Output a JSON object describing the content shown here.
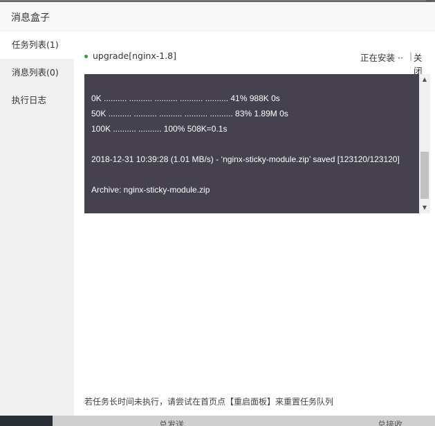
{
  "background": {
    "bottom_left_label": "总发送",
    "bottom_right_label": "总接收"
  },
  "modal": {
    "title": "消息盒子"
  },
  "sidebar": {
    "items": [
      {
        "label": "任务列表(1)",
        "active": true
      },
      {
        "label": "消息列表(0)",
        "active": false
      },
      {
        "label": "执行日志",
        "active": false
      }
    ]
  },
  "task": {
    "name": "upgrade[nginx-1.8]",
    "status": "正在安装 ··",
    "separator": "|",
    "close_label": "关闭",
    "status_color": "#20a53a"
  },
  "console": {
    "lines": [
      "0K .......... .......... .......... .......... .......... 41% 988K 0s",
      "50K .......... .......... .......... .......... .......... 83% 1.89M 0s",
      "100K .......... .......... 100% 508K=0.1s",
      "",
      "2018-12-31 10:39:28 (1.01 MB/s) - ‘nginx-sticky-module.zip’ saved [123120/123120]",
      "",
      "Archive: nginx-sticky-module.zip"
    ],
    "scroll_up": "▲",
    "scroll_down": "▼"
  },
  "footer_tip": "若任务长时间未执行，请尝试在首页点【重启面板】来重置任务队列"
}
